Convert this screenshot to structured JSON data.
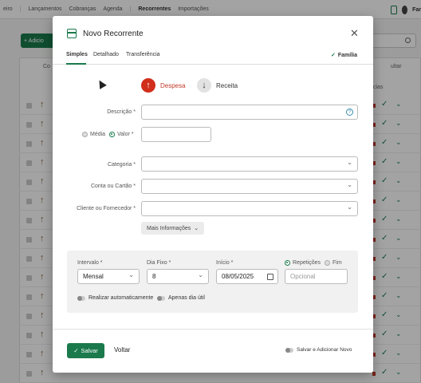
{
  "nav": {
    "items": [
      "eiro",
      "Lançamentos",
      "Cobranças",
      "Agenda",
      "Recorrentes",
      "Importações"
    ],
    "active": "Recorrentes",
    "user_label": "Far"
  },
  "background": {
    "add_button": "+ Adicio",
    "col_con": "Co",
    "col_ocultar": "ultar",
    "col_cias": "cias"
  },
  "modal": {
    "title": "Novo Recorrente",
    "tabs": [
      "Simples",
      "Detalhado",
      "Transferência"
    ],
    "active_tab": "Simples",
    "familia_label": "Família",
    "despesa_label": "Despesa",
    "receita_label": "Receita",
    "selected_type": "Despesa",
    "descricao_label": "Descrição *",
    "media_label": "Média",
    "valor_label": "Valor *",
    "valor_mode": "Valor",
    "categoria_label": "Categoria *",
    "conta_label": "Conta ou Cartão *",
    "cliente_label": "Cliente ou Fornecedor *",
    "mais_label": "Mais Informações",
    "intervalo_label": "Intervalo *",
    "intervalo_value": "Mensal",
    "dia_fixo_label": "Dia Fixo *",
    "dia_fixo_value": "8",
    "inicio_label": "Início *",
    "inicio_value": "08/05/2025",
    "repeticoes_label": "Repetições",
    "fim_label": "Fim",
    "end_mode": "Repetições",
    "repeticoes_placeholder": "Opcional",
    "realizar_label": "Realizar automaticamente",
    "apenas_label": "Apenas dia útil",
    "salvar_label": "Salvar",
    "voltar_label": "Voltar",
    "salvar_add_label": "Salvar e Adicionar Novo"
  },
  "colors": {
    "primary_green": "#1a7a4c",
    "despesa_red": "#d12e1c"
  }
}
